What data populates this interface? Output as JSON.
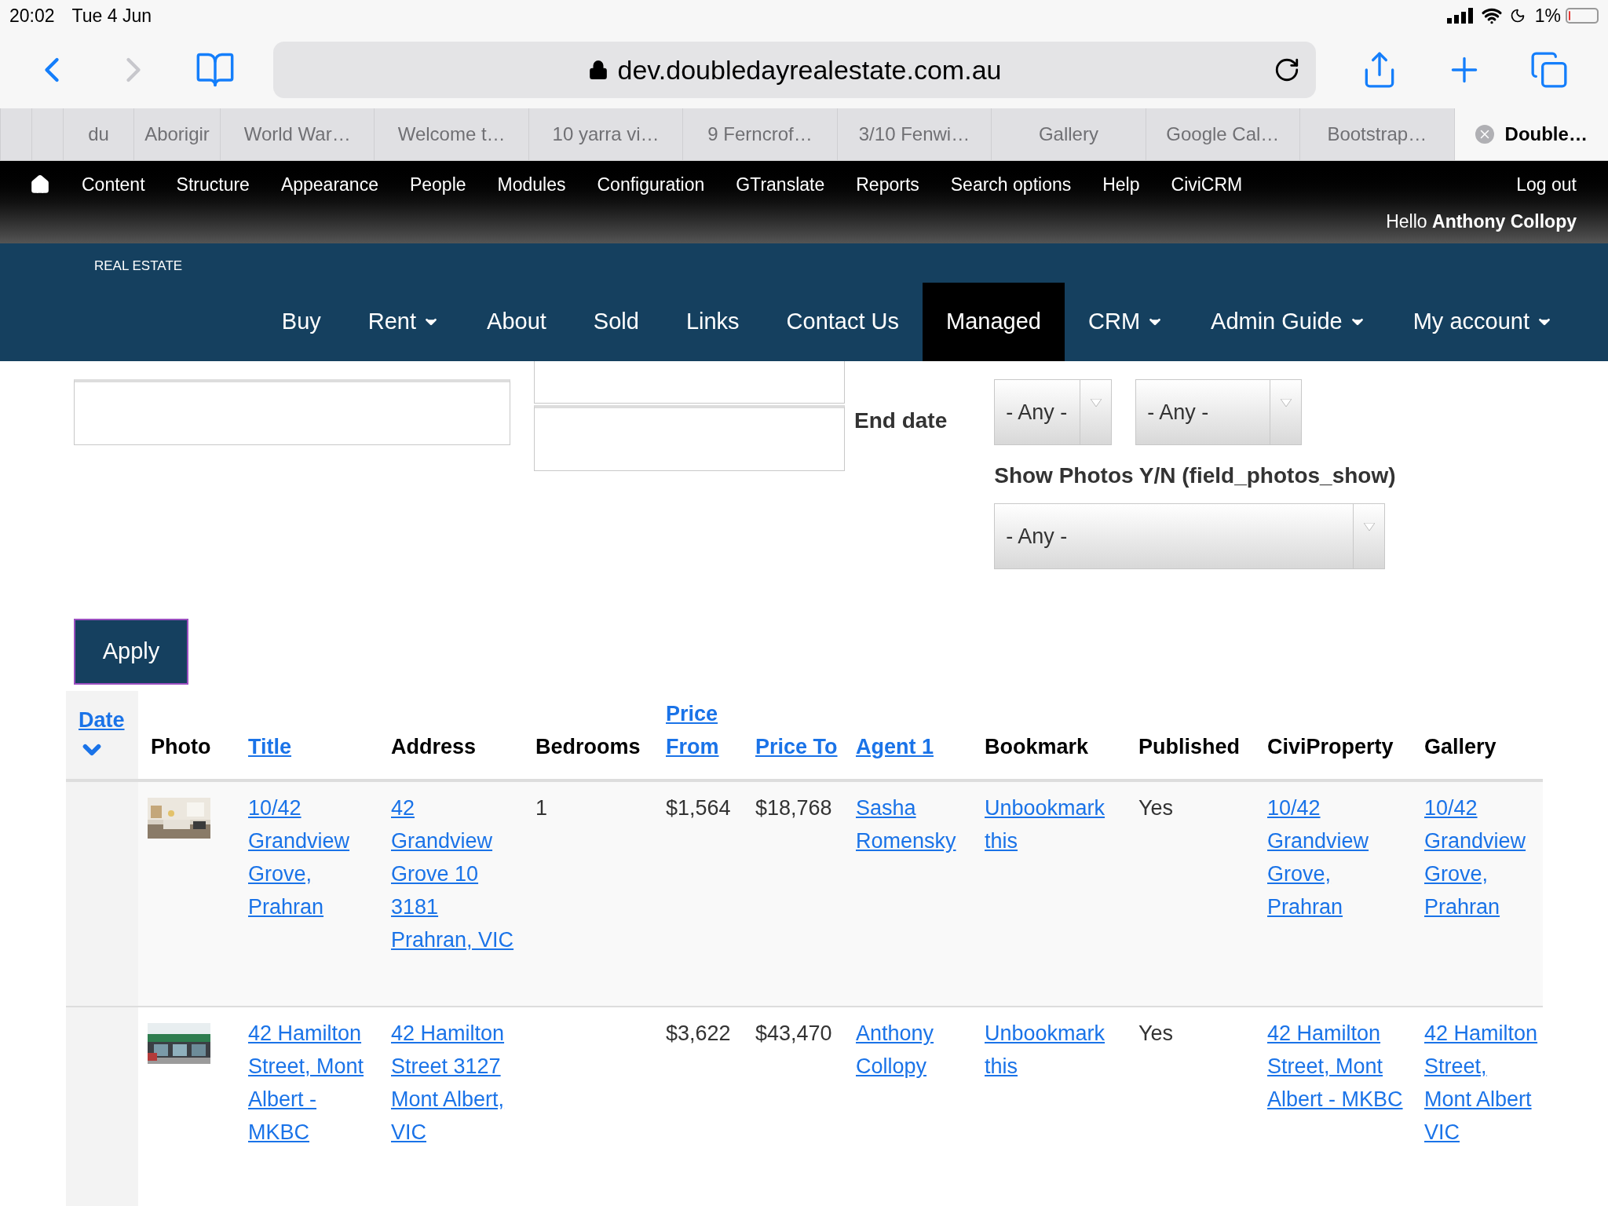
{
  "status_bar": {
    "time": "20:02",
    "date": "Tue 4 Jun",
    "battery": "1%"
  },
  "address_bar": {
    "url": "dev.doubledayrealestate.com.au"
  },
  "tabs": [
    {
      "selected": false
    },
    {
      "selected": false
    },
    {
      "label": "du",
      "selected": false
    },
    {
      "label": "Aborigir",
      "selected": false
    },
    {
      "label": "World War…",
      "selected": false
    },
    {
      "label": "Welcome t…",
      "selected": false
    },
    {
      "label": "10 yarra vi…",
      "selected": false
    },
    {
      "label": "9 Ferncrof…",
      "selected": false
    },
    {
      "label": "3/10 Fenwi…",
      "selected": false
    },
    {
      "label": "Gallery",
      "selected": false
    },
    {
      "label": "Google Cal…",
      "selected": false
    },
    {
      "label": "Bootstrap…",
      "selected": false
    },
    {
      "label": "Double…",
      "selected": true
    }
  ],
  "admin_menu": {
    "items": [
      "Content",
      "Structure",
      "Appearance",
      "People",
      "Modules",
      "Configuration",
      "GTranslate",
      "Reports",
      "Search options",
      "Help",
      "CiviCRM"
    ],
    "logout": "Log out",
    "greeting": "Hello",
    "user": "Anthony Collopy"
  },
  "site_header": {
    "logo_subtitle": "REAL ESTATE",
    "nav": [
      {
        "label": "Buy",
        "dropdown": false,
        "selected": false
      },
      {
        "label": "Rent",
        "dropdown": true,
        "selected": false
      },
      {
        "label": "About",
        "dropdown": false,
        "selected": false
      },
      {
        "label": "Sold",
        "dropdown": false,
        "selected": false
      },
      {
        "label": "Links",
        "dropdown": false,
        "selected": false
      },
      {
        "label": "Contact Us",
        "dropdown": false,
        "selected": false
      },
      {
        "label": "Managed",
        "dropdown": false,
        "selected": true
      },
      {
        "label": "CRM",
        "dropdown": true,
        "selected": false
      },
      {
        "label": "Admin Guide",
        "dropdown": true,
        "selected": false
      },
      {
        "label": "My account",
        "dropdown": true,
        "selected": false
      }
    ]
  },
  "filters": {
    "end_date_label": "End date",
    "selects": [
      "- Any -",
      "- Any -"
    ],
    "photos_label": "Show Photos Y/N (field_photos_show)",
    "photos_select": "- Any -",
    "apply": "Apply"
  },
  "table": {
    "columns": [
      {
        "label": "Date",
        "kind": "link",
        "sorted": true
      },
      {
        "label": "Photo",
        "kind": "plain",
        "sorted": false
      },
      {
        "label": "Title",
        "kind": "link",
        "sorted": false
      },
      {
        "label": "Address",
        "kind": "plain",
        "sorted": false
      },
      {
        "label": "Bedrooms",
        "kind": "plain",
        "sorted": false
      },
      {
        "label": "Price From",
        "kind": "link",
        "sorted": false
      },
      {
        "label": "Price To",
        "kind": "link",
        "sorted": false
      },
      {
        "label": "Agent 1",
        "kind": "link",
        "sorted": false
      },
      {
        "label": "Bookmark",
        "kind": "plain",
        "sorted": false
      },
      {
        "label": "Published",
        "kind": "plain",
        "sorted": false
      },
      {
        "label": "CiviProperty",
        "kind": "plain",
        "sorted": false
      },
      {
        "label": "Gallery",
        "kind": "plain",
        "sorted": false
      }
    ],
    "rows": [
      {
        "cells": [
          "",
          {
            "kind": "picture"
          },
          {
            "text": "10/42 Grandview Grove, Prahran",
            "link": true
          },
          {
            "text": "42 Grandview Grove 10 3181 Prahran, VIC",
            "link": true
          },
          {
            "text": "1",
            "link": false
          },
          {
            "text": "$1,564",
            "link": false
          },
          {
            "text": "$18,768",
            "link": false
          },
          {
            "text": "Sasha Romensky",
            "link": true
          },
          {
            "text": "Unbookmark this",
            "link": true
          },
          {
            "text": "Yes",
            "link": false
          },
          {
            "text": "10/42 Grandview Grove, Prahran",
            "link": true
          },
          {
            "text": "10/42 Grandview Grove, Prahran",
            "link": true
          }
        ]
      },
      {
        "cells": [
          "",
          {
            "kind": "picture"
          },
          {
            "text": "42 Hamilton Street, Mont Albert - MKBC",
            "link": true
          },
          {
            "text": "42 Hamilton Street 3127 Mont Albert, VIC",
            "link": true
          },
          "",
          {
            "text": "$3,622",
            "link": false
          },
          {
            "text": "$43,470",
            "link": false
          },
          {
            "text": "Anthony Collopy",
            "link": true
          },
          {
            "text": "Unbookmark this",
            "link": true
          },
          {
            "text": "Yes",
            "link": false
          },
          {
            "text": "42 Hamilton Street, Mont Albert - MKBC",
            "link": true
          },
          {
            "text": "42 Hamilton Street, Mont Albert VIC",
            "link": true
          }
        ]
      }
    ]
  }
}
